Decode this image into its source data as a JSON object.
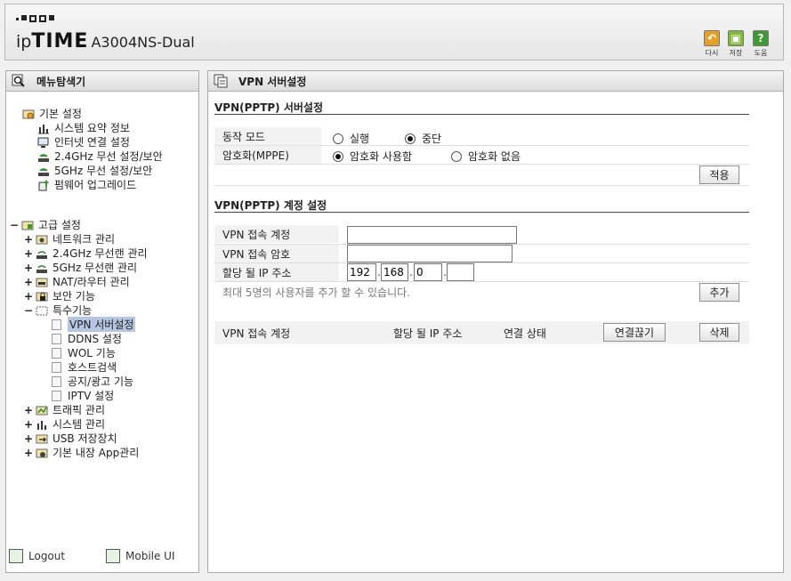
{
  "header": {
    "brand_ip": "ip",
    "brand_time": "TIME",
    "model": "A3004NS-Dual",
    "tools": [
      {
        "icon": "redo-icon",
        "label": "다시"
      },
      {
        "icon": "save-icon",
        "label": "저장"
      },
      {
        "icon": "help-icon",
        "label": "도움"
      }
    ]
  },
  "sidebar": {
    "title": "메뉴탐색기",
    "basic": {
      "label": "기본 설정",
      "items": [
        "시스템 요약 정보",
        "인터넷 연결 설정",
        "2.4GHz 무선 설정/보안",
        "5GHz 무선 설정/보안",
        "펌웨어 업그레이드"
      ]
    },
    "advanced": {
      "label": "고급 설정",
      "items": [
        "네트워크 관리",
        "2.4GHz 무선랜 관리",
        "5GHz 무선랜 관리",
        "NAT/라우터 관리",
        "보안 기능",
        "특수기능"
      ],
      "special_items": [
        "VPN 서버설정",
        "DDNS 설정",
        "WOL 기능",
        "호스트검색",
        "공지/광고 기능",
        "IPTV 설정"
      ],
      "more_items": [
        "트래픽 관리",
        "시스템 관리",
        "USB 저장장치",
        "기본 내장 App관리"
      ]
    },
    "logout": "Logout",
    "mobile": "Mobile UI"
  },
  "main": {
    "title": "VPN 서버설정",
    "server": {
      "title": "VPN(PPTP) 서버설정",
      "mode_label": "동작 모드",
      "mode_run": "실행",
      "mode_stop": "중단",
      "mode_selected": "중단",
      "enc_label": "암호화(MPPE)",
      "enc_on": "암호화 사용함",
      "enc_off": "암호화 없음",
      "enc_selected": "암호화 사용함",
      "apply": "적용"
    },
    "account": {
      "title": "VPN(PPTP) 계정 설정",
      "user_label": "VPN 접속 계정",
      "pass_label": "VPN 접속 암호",
      "ip_label": "할당 될 IP 주소",
      "ip_parts": [
        "192",
        "168",
        "0",
        ""
      ],
      "note": "최대 5명의 사용자를 추가 할 수 있습니다.",
      "add": "추가"
    },
    "list": {
      "col_user": "VPN 접속 계정",
      "col_ip": "할당 될 IP 주소",
      "col_status": "연결 상태",
      "disconnect": "연결끊기",
      "delete": "삭제"
    }
  }
}
